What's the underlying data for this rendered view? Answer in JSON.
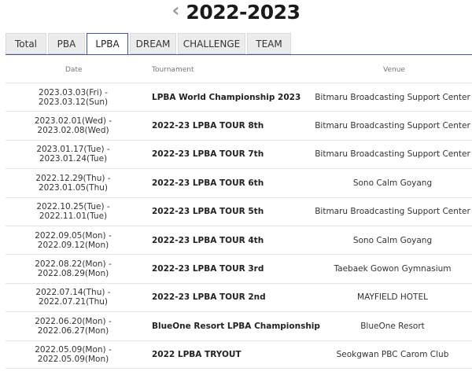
{
  "season": {
    "prev_icon": "chevron-left-icon",
    "title": "2022-2023"
  },
  "tabs": [
    "Total",
    "PBA",
    "LPBA",
    "DREAM",
    "CHALLENGE",
    "TEAM"
  ],
  "active_tab": "LPBA",
  "headers": {
    "date": "Date",
    "tournament": "Tournament",
    "venue": "Venue"
  },
  "rows": [
    {
      "date": "2023.03.03(Fri) - 2023.03.12(Sun)",
      "tournament": "LPBA World Championship 2023",
      "venue": "Bitmaru Broadcasting Support Center"
    },
    {
      "date": "2023.02.01(Wed) - 2023.02.08(Wed)",
      "tournament": "2022-23 LPBA TOUR 8th",
      "venue": "Bitmaru Broadcasting Support Center"
    },
    {
      "date": "2023.01.17(Tue) - 2023.01.24(Tue)",
      "tournament": "2022-23 LPBA TOUR 7th",
      "venue": "Bitmaru Broadcasting Support Center"
    },
    {
      "date": "2022.12.29(Thu) - 2023.01.05(Thu)",
      "tournament": "2022-23 LPBA TOUR 6th",
      "venue": "Sono Calm Goyang"
    },
    {
      "date": "2022.10.25(Tue) - 2022.11.01(Tue)",
      "tournament": "2022-23 LPBA TOUR 5th",
      "venue": "Bitmaru Broadcasting Support Center"
    },
    {
      "date": "2022.09.05(Mon) - 2022.09.12(Mon)",
      "tournament": "2022-23 LPBA TOUR 4th",
      "venue": "Sono Calm Goyang"
    },
    {
      "date": "2022.08.22(Mon) - 2022.08.29(Mon)",
      "tournament": "2022-23 LPBA TOUR 3rd",
      "venue": "Taebaek Gowon Gymnasium"
    },
    {
      "date": "2022.07.14(Thu) - 2022.07.21(Thu)",
      "tournament": "2022-23 LPBA TOUR 2nd",
      "venue": "MAYFIELD HOTEL"
    },
    {
      "date": "2022.06.20(Mon) - 2022.06.27(Mon)",
      "tournament": "BlueOne Resort LPBA Championship",
      "venue": "BlueOne Resort"
    },
    {
      "date": "2022.05.09(Mon) - 2022.05.09(Mon)",
      "tournament": "2022 LPBA TRYOUT",
      "venue": "Seokgwan PBC Carom Club"
    }
  ],
  "colors": {
    "accent": "#3b5998",
    "tab_bg": "#ececec",
    "divider": "#e4e4e4"
  }
}
